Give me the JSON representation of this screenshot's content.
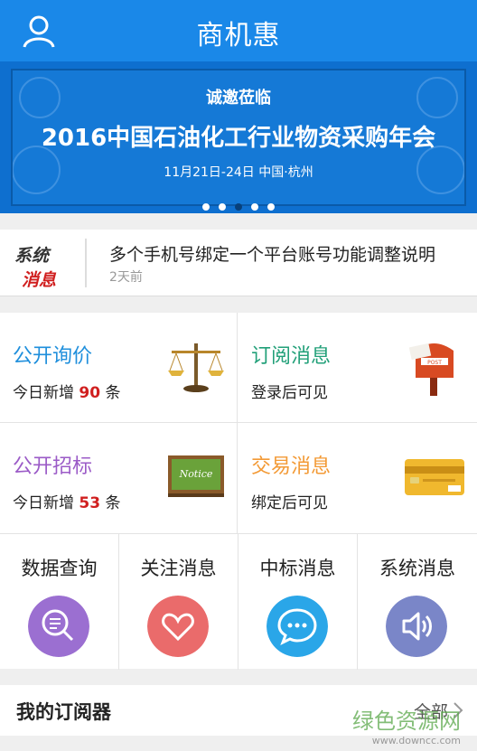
{
  "header": {
    "title": "商机惠"
  },
  "banner": {
    "line1": "诚邀莅临",
    "line2": "2016中国石油化工行业物资采购年会",
    "line3": "11月21日-24日    中国·杭州",
    "active_dot": 3
  },
  "notice": {
    "logo_text_top": "系统",
    "logo_text_bottom": "消息",
    "text": "多个手机号绑定一个平台账号功能调整说明",
    "time": "2天前"
  },
  "tiles": [
    {
      "title": "公开询价",
      "prefix": "今日新增 ",
      "count": "90",
      "suffix": " 条",
      "color": "#1f8fdc",
      "icon": "scale-icon"
    },
    {
      "title": "订阅消息",
      "subtitle": "登录后可见",
      "color": "#22a079",
      "icon": "mailbox-icon"
    },
    {
      "title": "公开招标",
      "prefix": "今日新增 ",
      "count": "53",
      "suffix": " 条",
      "color": "#9b5bc7",
      "icon": "notice-board-icon"
    },
    {
      "title": "交易消息",
      "subtitle": "绑定后可见",
      "color": "#f39a36",
      "icon": "credit-card-icon"
    }
  ],
  "quick": [
    {
      "label": "数据查询",
      "color": "#9b6fd1",
      "icon": "search-list-icon"
    },
    {
      "label": "关注消息",
      "color": "#ea6b6b",
      "icon": "heart-icon"
    },
    {
      "label": "中标消息",
      "color": "#2aa6e8",
      "icon": "chat-bubble-icon"
    },
    {
      "label": "系统消息",
      "color": "#7a86c8",
      "icon": "speaker-icon"
    }
  ],
  "subscription": {
    "label": "我的订阅器",
    "more": "全部"
  },
  "watermark": {
    "line1": "绿色资源网",
    "line2": "www.downcc.com"
  }
}
